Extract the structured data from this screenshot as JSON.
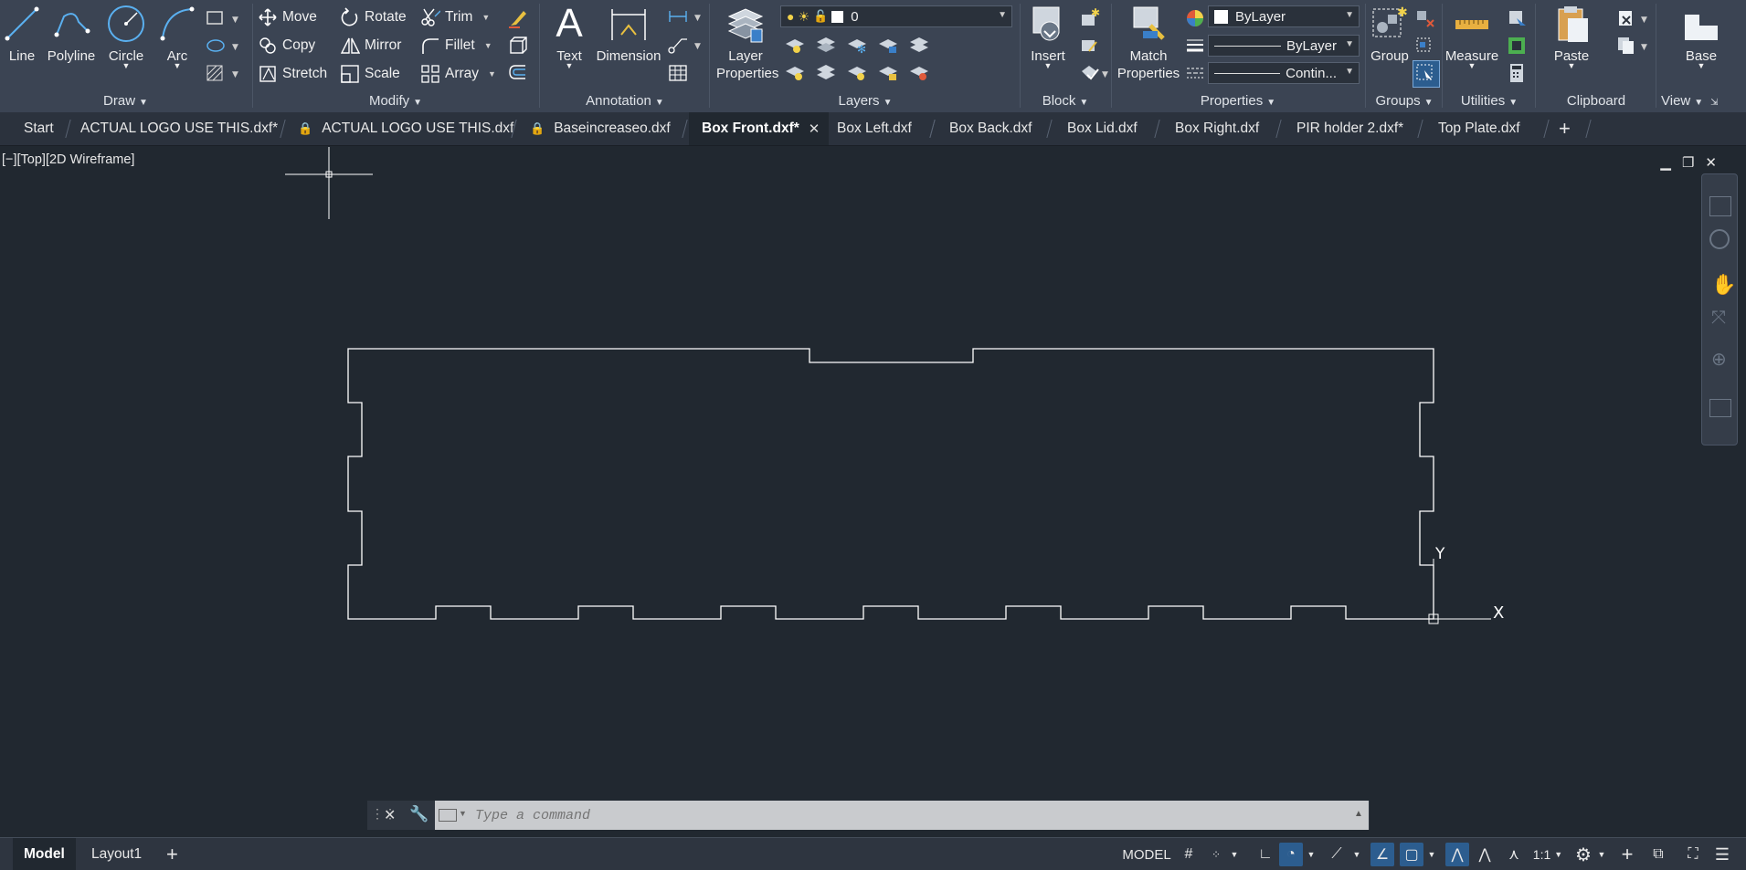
{
  "ribbon": {
    "draw": {
      "title": "Draw",
      "line": "Line",
      "polyline": "Polyline",
      "circle": "Circle",
      "arc": "Arc"
    },
    "modify": {
      "title": "Modify",
      "move": "Move",
      "rotate": "Rotate",
      "trim": "Trim",
      "copy": "Copy",
      "mirror": "Mirror",
      "fillet": "Fillet",
      "stretch": "Stretch",
      "scale": "Scale",
      "array": "Array"
    },
    "annotation": {
      "title": "Annotation",
      "text": "Text",
      "dimension": "Dimension"
    },
    "layers": {
      "title": "Layers",
      "layer_properties": "Layer Properties",
      "current_layer": "0"
    },
    "block": {
      "title": "Block",
      "insert": "Insert"
    },
    "properties": {
      "title": "Properties",
      "match_properties": "Match Properties",
      "color": "ByLayer",
      "lineweight": "ByLayer",
      "linetype": "Contin..."
    },
    "groups": {
      "title": "Groups",
      "group": "Group"
    },
    "utilities": {
      "title": "Utilities",
      "measure": "Measure"
    },
    "clipboard": {
      "title": "Clipboard",
      "paste": "Paste"
    },
    "view": {
      "title": "View",
      "base": "Base"
    }
  },
  "tabs": [
    {
      "label": "Start",
      "locked": false
    },
    {
      "label": "ACTUAL LOGO USE THIS.dxf*",
      "locked": false
    },
    {
      "label": "ACTUAL LOGO USE THIS.dxf",
      "locked": true
    },
    {
      "label": "Baseincreaseo.dxf",
      "locked": true
    },
    {
      "label": "Box Front.dxf*",
      "locked": false,
      "active": true
    },
    {
      "label": "Box Left.dxf",
      "locked": false
    },
    {
      "label": "Box Back.dxf",
      "locked": false
    },
    {
      "label": "Box Lid.dxf",
      "locked": false
    },
    {
      "label": "Box Right.dxf",
      "locked": false
    },
    {
      "label": "PIR holder 2.dxf*",
      "locked": false
    },
    {
      "label": "Top Plate.dxf",
      "locked": false
    }
  ],
  "viewport": {
    "label": "[−][Top][2D Wireframe]",
    "ucs_x": "X",
    "ucs_y": "Y"
  },
  "command": {
    "placeholder": "Type a command"
  },
  "status": {
    "model_tab": "Model",
    "layout_tab": "Layout1",
    "model_button": "MODEL",
    "scale": "1:1"
  },
  "colors": {
    "ribbon_bg": "#3b4453",
    "canvas_bg": "#212830",
    "accent_blue": "#2c5d8f",
    "geometry": "#ffffff"
  }
}
